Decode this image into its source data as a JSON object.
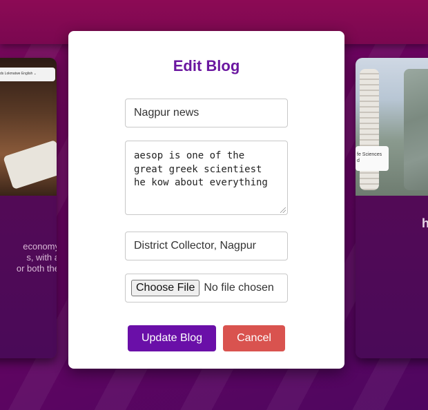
{
  "background": {
    "left_card": {
      "nav_snippet": "ds    Lokmatwe    English ⌄",
      "text": "economy\ns, with a\nor both the"
    },
    "right_card": {
      "info_chip": "fe Sciences\nd",
      "text": "h"
    }
  },
  "modal": {
    "title": "Edit Blog",
    "title_input_value": "Nagpur news",
    "content_value": "aesop is one of the\ngreat greek scientiest\nhe kow about everything",
    "author_input_value": "District Collector, Nagpur",
    "file_button_label": "Choose File",
    "file_status": "No file chosen",
    "update_button_label": "Update Blog",
    "cancel_button_label": "Cancel"
  },
  "colors": {
    "accent": "#6a0fa8",
    "title": "#6b17a0",
    "cancel": "#d9534f",
    "background": "#6a0462"
  }
}
